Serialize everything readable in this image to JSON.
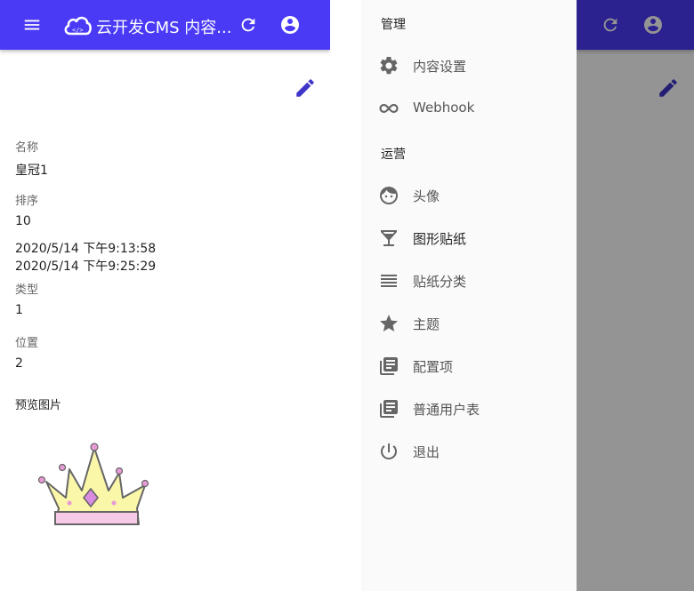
{
  "app": {
    "title": "云开发CMS 内容...",
    "accent": "#4a3af6"
  },
  "detail": {
    "fields": [
      {
        "label": "名称",
        "value": "皇冠1"
      },
      {
        "label": "排序",
        "value": "10"
      },
      {
        "timestamps": [
          "2020/5/14 下午9:13:58",
          "2020/5/14 下午9:25:29"
        ]
      },
      {
        "label": "类型",
        "value": "1"
      },
      {
        "label": "位置",
        "value": "2"
      }
    ],
    "preview_label": "预览图片"
  },
  "drawer": {
    "sections": [
      {
        "title": "管理",
        "items": [
          {
            "label": "内容设置",
            "icon": "gear-icon"
          },
          {
            "label": "Webhook",
            "icon": "infinity-icon"
          }
        ]
      },
      {
        "title": "运营",
        "items": [
          {
            "label": "头像",
            "icon": "face-icon"
          },
          {
            "label": "图形贴纸",
            "icon": "cocktail-icon"
          },
          {
            "label": "贴纸分类",
            "icon": "list-lines-icon"
          },
          {
            "label": "主题",
            "icon": "star-icon"
          },
          {
            "label": "配置项",
            "icon": "library-books-icon"
          },
          {
            "label": "普通用户表",
            "icon": "library-books-icon"
          },
          {
            "label": "退出",
            "icon": "power-icon"
          }
        ]
      }
    ]
  }
}
